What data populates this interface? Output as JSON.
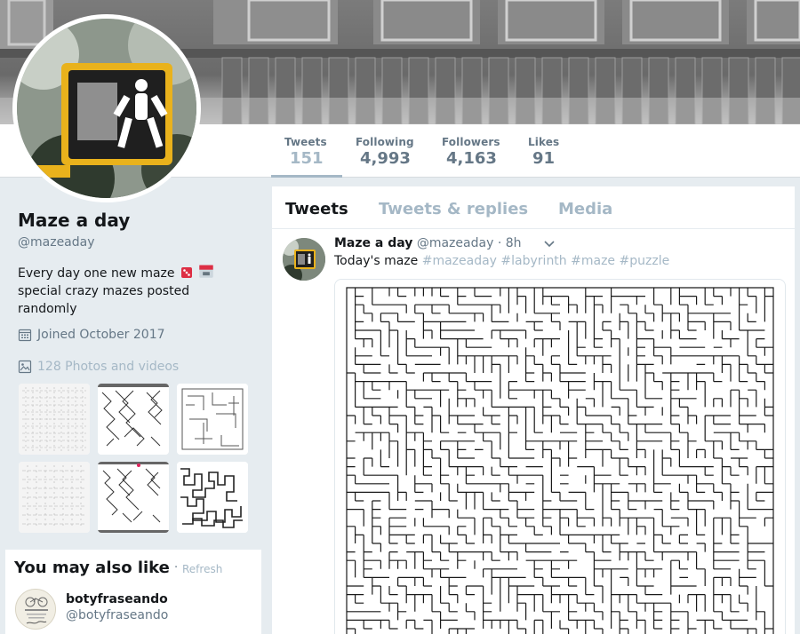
{
  "profile": {
    "name": "Maze a day",
    "handle": "@mazeaday",
    "bio_line1": "Every day one new maze",
    "bio_line2": "special crazy mazes posted randomly",
    "joined": "Joined October 2017",
    "photos_link": "128 Photos and videos"
  },
  "stats": [
    {
      "label": "Tweets",
      "value": "151"
    },
    {
      "label": "Following",
      "value": "4,993"
    },
    {
      "label": "Followers",
      "value": "4,163"
    },
    {
      "label": "Likes",
      "value": "91"
    }
  ],
  "tabs": [
    {
      "label": "Tweets"
    },
    {
      "label": "Tweets & replies"
    },
    {
      "label": "Media"
    }
  ],
  "tweet": {
    "name": "Maze a day",
    "handle": "@mazeaday",
    "time": "· 8h",
    "text": "Today's maze",
    "hashtags": [
      "#mazeaday",
      "#labyrinth",
      "#maze",
      "#puzzle"
    ]
  },
  "who_to_follow": {
    "title": "You may also like",
    "separator": "·",
    "refresh": "Refresh",
    "user": {
      "name": "botyfraseando",
      "handle": "@botyfraseando"
    }
  },
  "icons": {
    "calendar": "calendar-icon",
    "photo": "photo-icon",
    "caret": "chevron-down-icon"
  },
  "colors": {
    "accent_muted": "#a5b8c6",
    "text_secondary": "#657786",
    "background": "#e6ecf0"
  }
}
